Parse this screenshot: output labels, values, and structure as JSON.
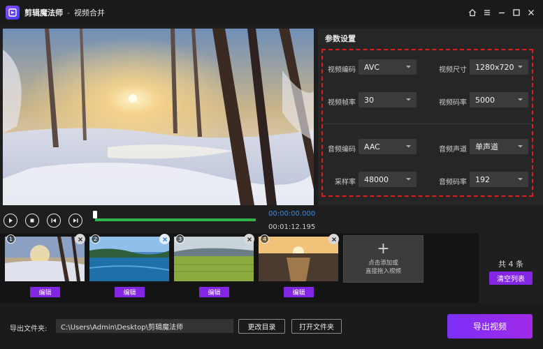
{
  "titlebar": {
    "app_name": "剪辑魔法师",
    "separator": "-",
    "module_name": "视频合并",
    "icons": [
      "home-icon",
      "menu-icon",
      "minimize-icon",
      "maximize-icon",
      "close-icon"
    ]
  },
  "player": {
    "current_time": "00:00:00.000",
    "total_time": "00:01:12.195",
    "progress": 0.0,
    "buttons": [
      "play-icon",
      "stop-icon",
      "prev-frame-icon",
      "next-frame-icon"
    ]
  },
  "settings": {
    "title": "参数设置",
    "video_codec": {
      "label": "视频编码",
      "value": "AVC"
    },
    "video_size": {
      "label": "视频尺寸",
      "value": "1280x720"
    },
    "frame_rate": {
      "label": "视频帧率",
      "value": "30"
    },
    "video_bitrate": {
      "label": "视频码率",
      "value": "5000"
    },
    "audio_codec": {
      "label": "音频编码",
      "value": "AAC"
    },
    "audio_channel": {
      "label": "音频声道",
      "value": "单声道"
    },
    "sample_rate": {
      "label": "采样率",
      "value": "48000"
    },
    "audio_bitrate": {
      "label": "音频码率",
      "value": "192"
    },
    "highlight_color": "#e41b1b"
  },
  "clips": [
    {
      "number": "1",
      "edit_label": "编辑"
    },
    {
      "number": "2",
      "edit_label": "编辑"
    },
    {
      "number": "3",
      "edit_label": "编辑"
    },
    {
      "number": "4",
      "edit_label": "编辑"
    }
  ],
  "add_tile": {
    "plus": "+",
    "line1": "点击添加或",
    "line2": "直接拖入视频"
  },
  "list_panel": {
    "count_text": "共 4 条",
    "clear_label": "清空列表"
  },
  "export": {
    "folder_label": "导出文件夹:",
    "path": "C:\\Users\\Admin\\Desktop\\剪辑魔法师",
    "change_dir_label": "更改目录",
    "open_folder_label": "打开文件夹",
    "export_label": "导出视频"
  },
  "colors": {
    "accent_purple": "#8226e3",
    "progress_green": "#2fb34a",
    "time_blue": "#2f8cff"
  }
}
